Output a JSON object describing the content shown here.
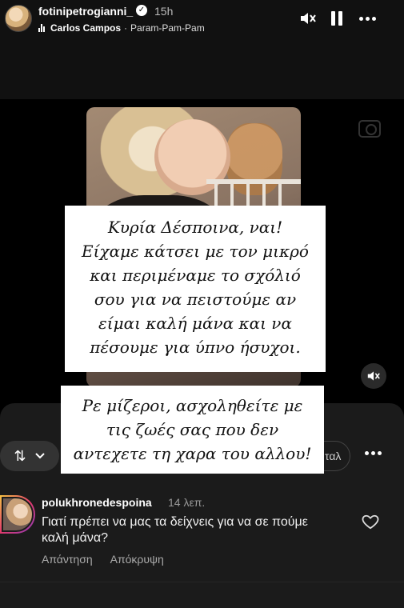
{
  "story": {
    "username": "fotinipetrogianni_",
    "time": "15h",
    "music": {
      "artist": "Carlos Campos",
      "separator": "·",
      "song": "Param-Pam-Pam"
    }
  },
  "overlay": {
    "caption1": [
      "Κυρία Δέσποινα, ναι!",
      "Είχαμε κάτσει με τον μικρό",
      "και περιμέναμε το σχόλιό",
      "σου για να πειστούμε αν",
      "είμαι καλή μάνα και να",
      "πέσουμε για ύπνο ήσυχοι."
    ],
    "caption2": [
      "Ρε μίζεροι, ασχοληθείτε με",
      "τις ζωές σας που δεν",
      "αντεχετε τη χαρα του αλλου!"
    ]
  },
  "panel": {
    "sort_label": "⇅",
    "chip_partial": "ταλ"
  },
  "comment": {
    "username": "polukhronedespoina",
    "time": "14 λεπ.",
    "text": "Γιατί πρέπει να μας τα δείχνεις για να σε πούμε καλή μάνα?",
    "reply": "Απάντηση",
    "hide": "Απόκρυψη"
  }
}
